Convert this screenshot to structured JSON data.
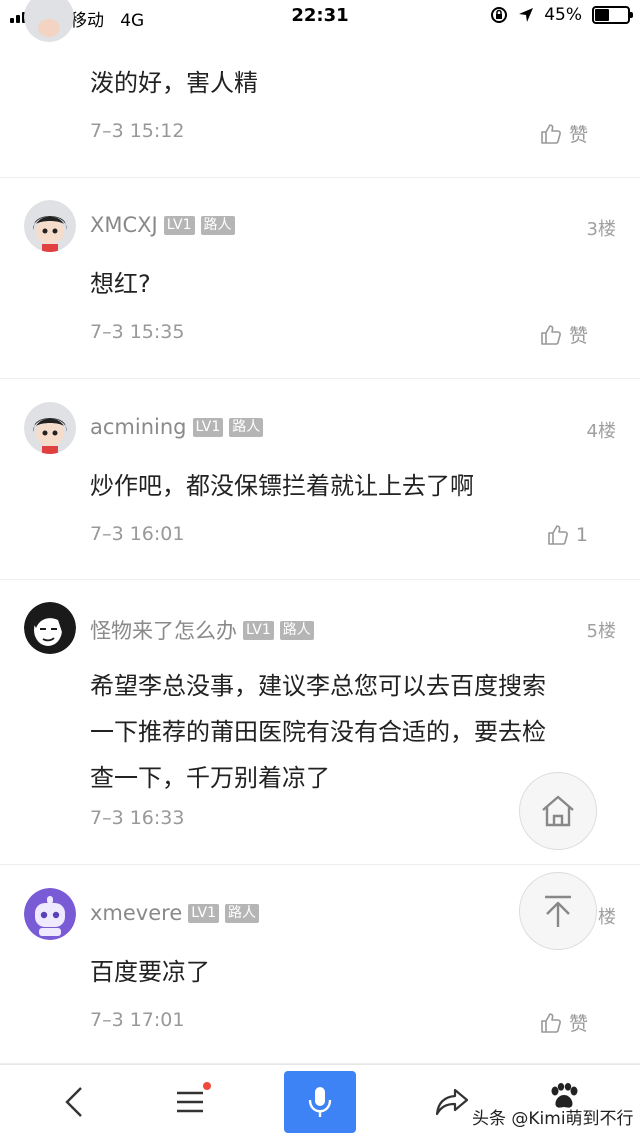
{
  "status_bar": {
    "carrier": "中国移动",
    "network": "4G",
    "time": "22:31",
    "battery": "45%",
    "battery_level": 0.45
  },
  "comments": [
    {
      "text": "泼的好，害人精",
      "time": "7–3 15:12",
      "like": "赞"
    },
    {
      "user": "XMCXJ",
      "level": "LV1",
      "role": "路人",
      "floor": "3楼",
      "text": "想红?",
      "time": "7–3 15:35",
      "like": "赞"
    },
    {
      "user": "acmining",
      "level": "LV1",
      "role": "路人",
      "floor": "4楼",
      "text": "炒作吧，都没保镖拦着就让上去了啊",
      "time": "7–3 16:01",
      "like": "1"
    },
    {
      "user": "怪物来了怎么办",
      "level": "LV1",
      "role": "路人",
      "floor": "5楼",
      "text_lines": [
        "希望李总没事，建议李总您可以去百度搜索",
        "一下推荐的莆田医院有没有合适的，要去检",
        "查一下，千万别着凉了"
      ],
      "time": "7–3 16:33"
    },
    {
      "user": "xmevere",
      "level": "LV1",
      "role": "路人",
      "floor": "楼",
      "text": "百度要凉了",
      "time": "7–3 17:01",
      "like": "赞"
    }
  ],
  "watermark": "头条 @Kimi萌到不行",
  "colors": {
    "accent": "#3d83f5",
    "notification": "#f04a3c"
  }
}
